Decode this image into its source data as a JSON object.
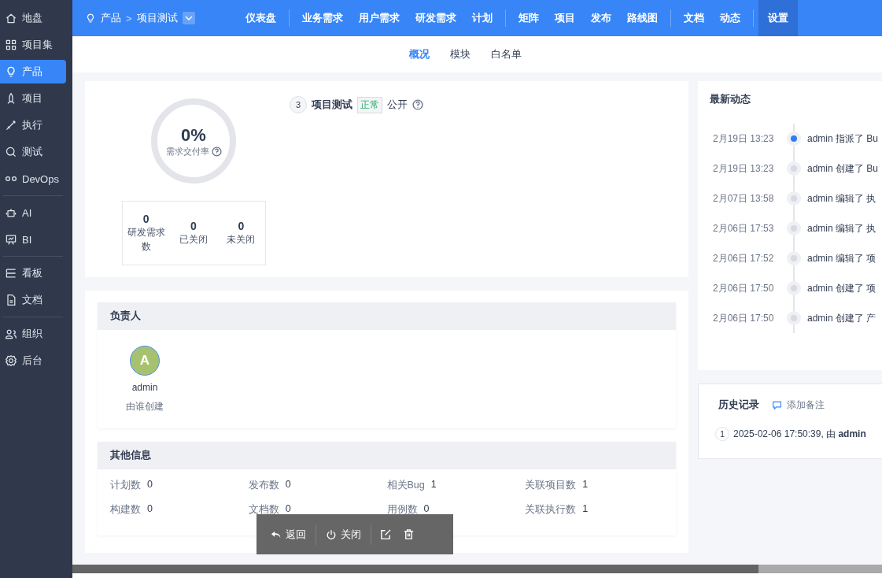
{
  "sidebar": {
    "groups": [
      [
        {
          "label": "地盘",
          "selected": false
        },
        {
          "label": "项目集",
          "selected": false
        },
        {
          "label": "产品",
          "selected": true
        },
        {
          "label": "项目",
          "selected": false
        },
        {
          "label": "执行",
          "selected": false
        },
        {
          "label": "测试",
          "selected": false
        },
        {
          "label": "DevOps",
          "selected": false
        }
      ],
      [
        {
          "label": "AI",
          "selected": false
        },
        {
          "label": "BI",
          "selected": false
        }
      ],
      [
        {
          "label": "看板",
          "selected": false
        },
        {
          "label": "文档",
          "selected": false
        }
      ],
      [
        {
          "label": "组织",
          "selected": false
        },
        {
          "label": "后台",
          "selected": false
        }
      ]
    ]
  },
  "breadcrumb": {
    "root": "产品",
    "separator": ">",
    "current": "项目测试"
  },
  "nav": {
    "groups": [
      [
        {
          "label": "仪表盘",
          "selected": false
        }
      ],
      [
        {
          "label": "业务需求",
          "selected": false
        },
        {
          "label": "用户需求",
          "selected": false
        },
        {
          "label": "研发需求",
          "selected": false
        },
        {
          "label": "计划",
          "selected": false
        }
      ],
      [
        {
          "label": "矩阵",
          "selected": false
        },
        {
          "label": "项目",
          "selected": false
        },
        {
          "label": "发布",
          "selected": false
        },
        {
          "label": "路线图",
          "selected": false
        }
      ],
      [
        {
          "label": "文档",
          "selected": false
        },
        {
          "label": "动态",
          "selected": false
        }
      ],
      [
        {
          "label": "设置",
          "selected": true
        }
      ]
    ]
  },
  "subnav": [
    {
      "label": "概况",
      "selected": true
    },
    {
      "label": "模块",
      "selected": false
    },
    {
      "label": "白名单",
      "selected": false
    }
  ],
  "overview": {
    "rate": "0%",
    "rate_label": "需求交付率",
    "stats": [
      {
        "value": "0",
        "label": "研发需求数"
      },
      {
        "value": "0",
        "label": "已关闭"
      },
      {
        "value": "0",
        "label": "未关闭"
      }
    ],
    "id": "3",
    "name": "项目测试",
    "status": "正常",
    "access": "公开"
  },
  "owner": {
    "title": "负责人",
    "avatar": "A",
    "name": "admin",
    "role": "由谁创建"
  },
  "other": {
    "title": "其他信息",
    "items": [
      {
        "label": "计划数",
        "value": "0"
      },
      {
        "label": "发布数",
        "value": "0"
      },
      {
        "label": "相关Bug",
        "value": "1"
      },
      {
        "label": "关联项目数",
        "value": "1"
      },
      {
        "label": "构建数",
        "value": "0"
      },
      {
        "label": "文档数",
        "value": "0"
      },
      {
        "label": "用例数",
        "value": "0"
      },
      {
        "label": "关联执行数",
        "value": "1"
      }
    ]
  },
  "toolbar": {
    "back": "返回",
    "close": "关闭"
  },
  "dynamics": {
    "title": "最新动态",
    "items": [
      {
        "time": "2月19日 13:23",
        "text": "admin 指派了 Bu",
        "selected": true
      },
      {
        "time": "2月19日 13:23",
        "text": "admin 创建了 Bu",
        "selected": false
      },
      {
        "time": "2月07日 13:58",
        "text": "admin 编辑了 执",
        "selected": false
      },
      {
        "time": "2月06日 17:53",
        "text": "admin 编辑了 执",
        "selected": false
      },
      {
        "time": "2月06日 17:52",
        "text": "admin 编辑了 项",
        "selected": false
      },
      {
        "time": "2月06日 17:50",
        "text": "admin 创建了 项",
        "selected": false
      },
      {
        "time": "2月06日 17:50",
        "text": "admin 创建了 产",
        "selected": false
      }
    ]
  },
  "history": {
    "title": "历史记录",
    "add_note": "添加备注",
    "items": [
      {
        "index": "1",
        "text": "2025-02-06 17:50:39, 由 **admin**"
      }
    ]
  }
}
